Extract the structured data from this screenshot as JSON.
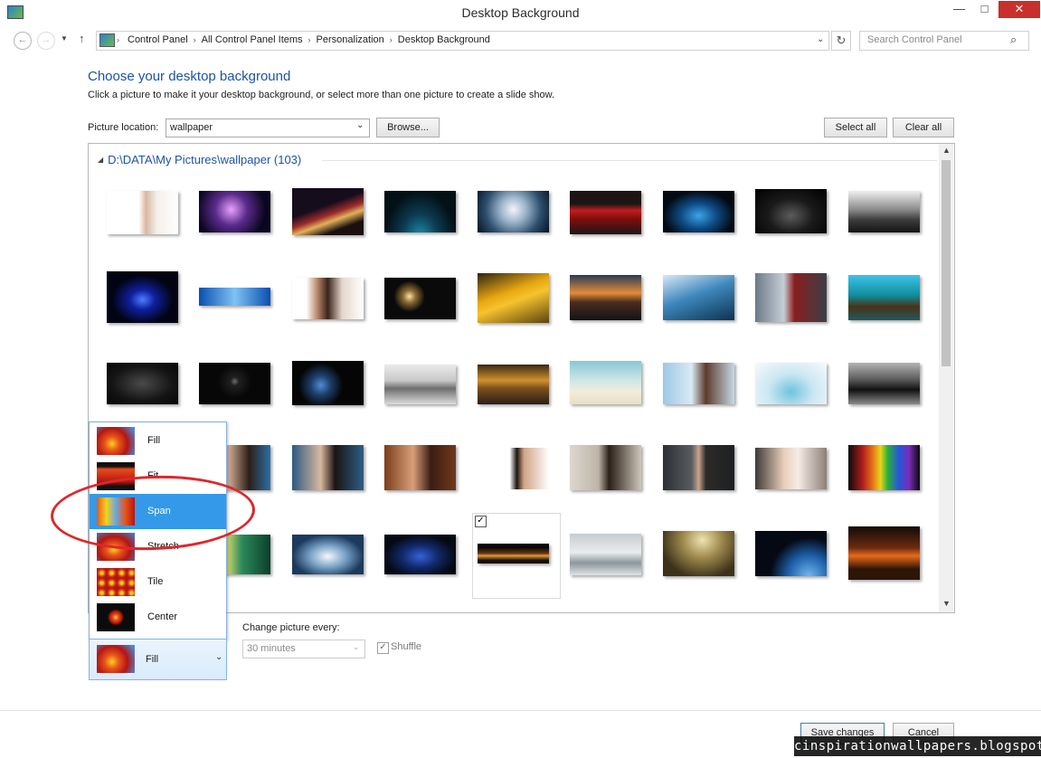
{
  "window": {
    "title": "Desktop Background",
    "minimize": "—",
    "maximize": "□",
    "close": "✕"
  },
  "nav": {
    "breadcrumbs": [
      "Control Panel",
      "All Control Panel Items",
      "Personalization",
      "Desktop Background"
    ],
    "search_placeholder": "Search Control Panel"
  },
  "main": {
    "heading": "Choose your desktop background",
    "subheading": "Click a picture to make it your desktop background, or select more than one picture to create a slide show.",
    "picture_location_label": "Picture location:",
    "picture_location_value": "wallpaper",
    "browse_label": "Browse...",
    "select_all_label": "Select all",
    "clear_all_label": "Clear all"
  },
  "gallery": {
    "group_header": "D:\\DATA\\My Pictures\\wallpaper (103)",
    "selected_check": "✓"
  },
  "position_menu": {
    "items": [
      "Fill",
      "Fit",
      "Span",
      "Stretch",
      "Tile",
      "Center"
    ],
    "selected": "Span",
    "current_value": "Fill"
  },
  "slideshow": {
    "change_label": "Change picture every:",
    "interval_value": "30 minutes",
    "shuffle_label": "Shuffle",
    "shuffle_checked": "✓"
  },
  "footer": {
    "save_label": "Save changes",
    "cancel_label": "Cancel"
  },
  "watermark": "cinspirationwallpapers.blogspot.com",
  "colors": {
    "accent_blue": "#1b53a7",
    "selection_blue": "#3599ea",
    "close_red": "#c7302b",
    "annotation_red": "#e0262b"
  }
}
